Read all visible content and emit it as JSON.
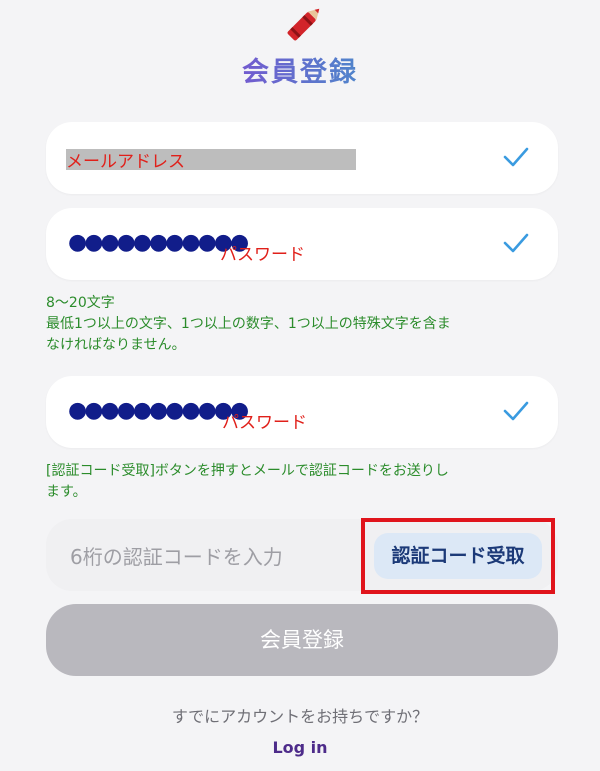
{
  "header": {
    "title": "会員登録",
    "logo_icon": "crayon-icon"
  },
  "email_field": {
    "label": "メールアドレス",
    "valid": true,
    "status_icon": "checkmark-icon"
  },
  "password_field": {
    "masked_value": "●●●●●●●●●●●",
    "label": "パスワード",
    "valid": true,
    "status_icon": "checkmark-icon"
  },
  "password_hint": {
    "line1": "8〜20文字",
    "line2": "最低1つ以上の文字、1つ以上の数字、1つ以上の特殊文字を含ま",
    "line3": "なければなりません。"
  },
  "confirm_password_field": {
    "masked_value": "●●●●●●●●●●●",
    "label": "パスワード",
    "valid": true,
    "status_icon": "checkmark-icon"
  },
  "code_hint": {
    "line1": "[認証コード受取]ボタンを押すとメールで認証コードをお送りし",
    "line2": "ます。"
  },
  "code_field": {
    "placeholder": "6桁の認証コードを入力",
    "value": ""
  },
  "code_button": {
    "label": "認証コード受取"
  },
  "submit_button": {
    "label": "会員登録",
    "enabled": false
  },
  "footer": {
    "have_account_text": "すでにアカウントをお持ちですか？",
    "login_link": "Log in"
  },
  "colors": {
    "accent_check": "#3a9be0",
    "hint_green": "#2b8c2b",
    "annotation_red": "#e0201a",
    "highlight_border": "#e0141c",
    "submit_disabled": "#b9b8be"
  }
}
